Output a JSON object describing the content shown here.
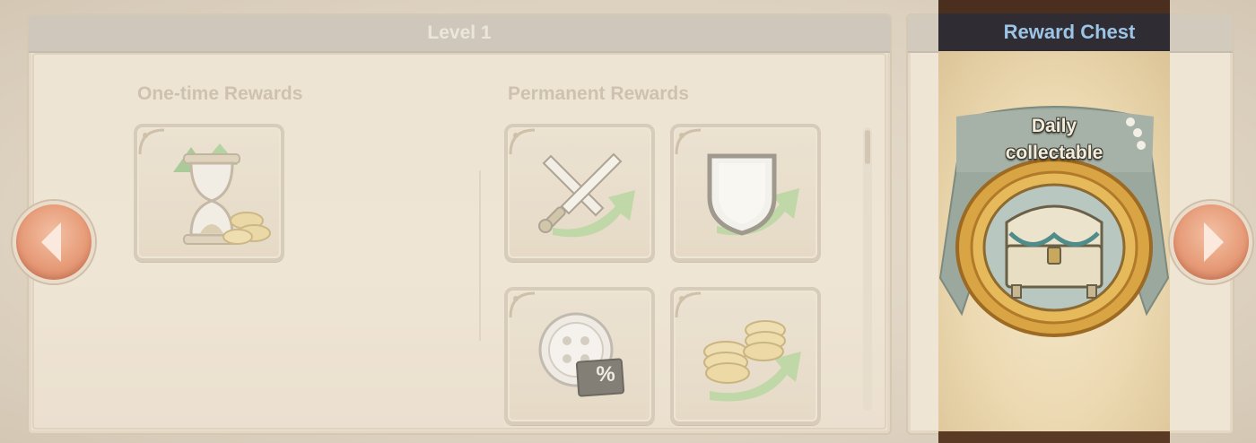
{
  "level_panel": {
    "title": "Level 1",
    "one_time_title": "One-time Rewards",
    "permanent_title": "Permanent Rewards"
  },
  "one_time_rewards": [
    {
      "icon": "hourglass-coins-icon"
    }
  ],
  "permanent_rewards": [
    {
      "icon": "attack-boost-icon"
    },
    {
      "icon": "defense-boost-icon"
    },
    {
      "icon": "discount-coin-icon",
      "badge": "%"
    },
    {
      "icon": "coin-boost-icon"
    }
  ],
  "chest_panel": {
    "title": "Reward Chest",
    "label_line1": "Daily",
    "label_line2": "collectable",
    "icon": "treasure-chest-icon"
  },
  "nav": {
    "prev_icon": "chevron-left-icon",
    "next_icon": "chevron-right-icon"
  },
  "colors": {
    "chest_title": "#9cc4e6",
    "nav_button": "#e79c79",
    "panel_bg": "#ece1cf"
  }
}
